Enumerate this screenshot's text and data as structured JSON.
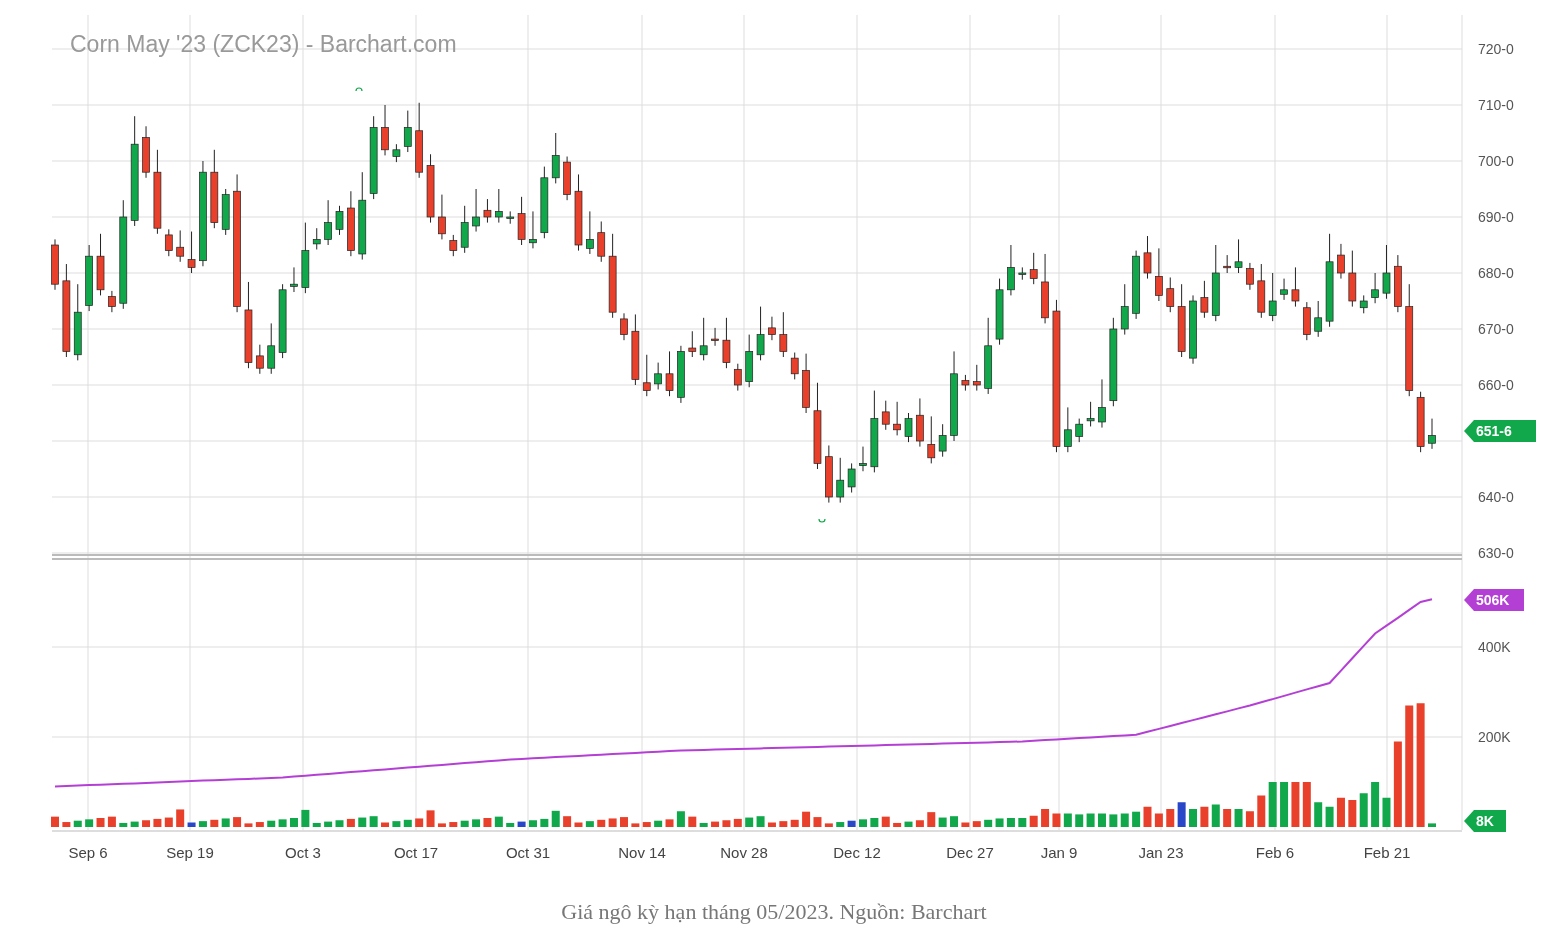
{
  "price_panel": {
    "title": "Corn May '23 (ZCK23) - Barchart.com",
    "y_axis_labels": [
      "720-0",
      "710-0",
      "700-0",
      "690-0",
      "680-0",
      "670-0",
      "660-0",
      "640-0",
      "630-0"
    ],
    "last_price_badge": "651-6"
  },
  "volume_panel": {
    "y_axis_labels": [
      "400K",
      "200K"
    ],
    "open_interest_badge": "506K",
    "volume_badge": "8K"
  },
  "x_axis_labels": [
    "Sep 6",
    "Sep 19",
    "Oct 3",
    "Oct 17",
    "Oct 31",
    "Nov 14",
    "Nov 28",
    "Dec 12",
    "Dec 27",
    "Jan 9",
    "Jan 23",
    "Feb 6",
    "Feb 21"
  ],
  "caption": "Giá ngô kỳ hạn tháng 05/2023. Nguồn: Barchart"
}
